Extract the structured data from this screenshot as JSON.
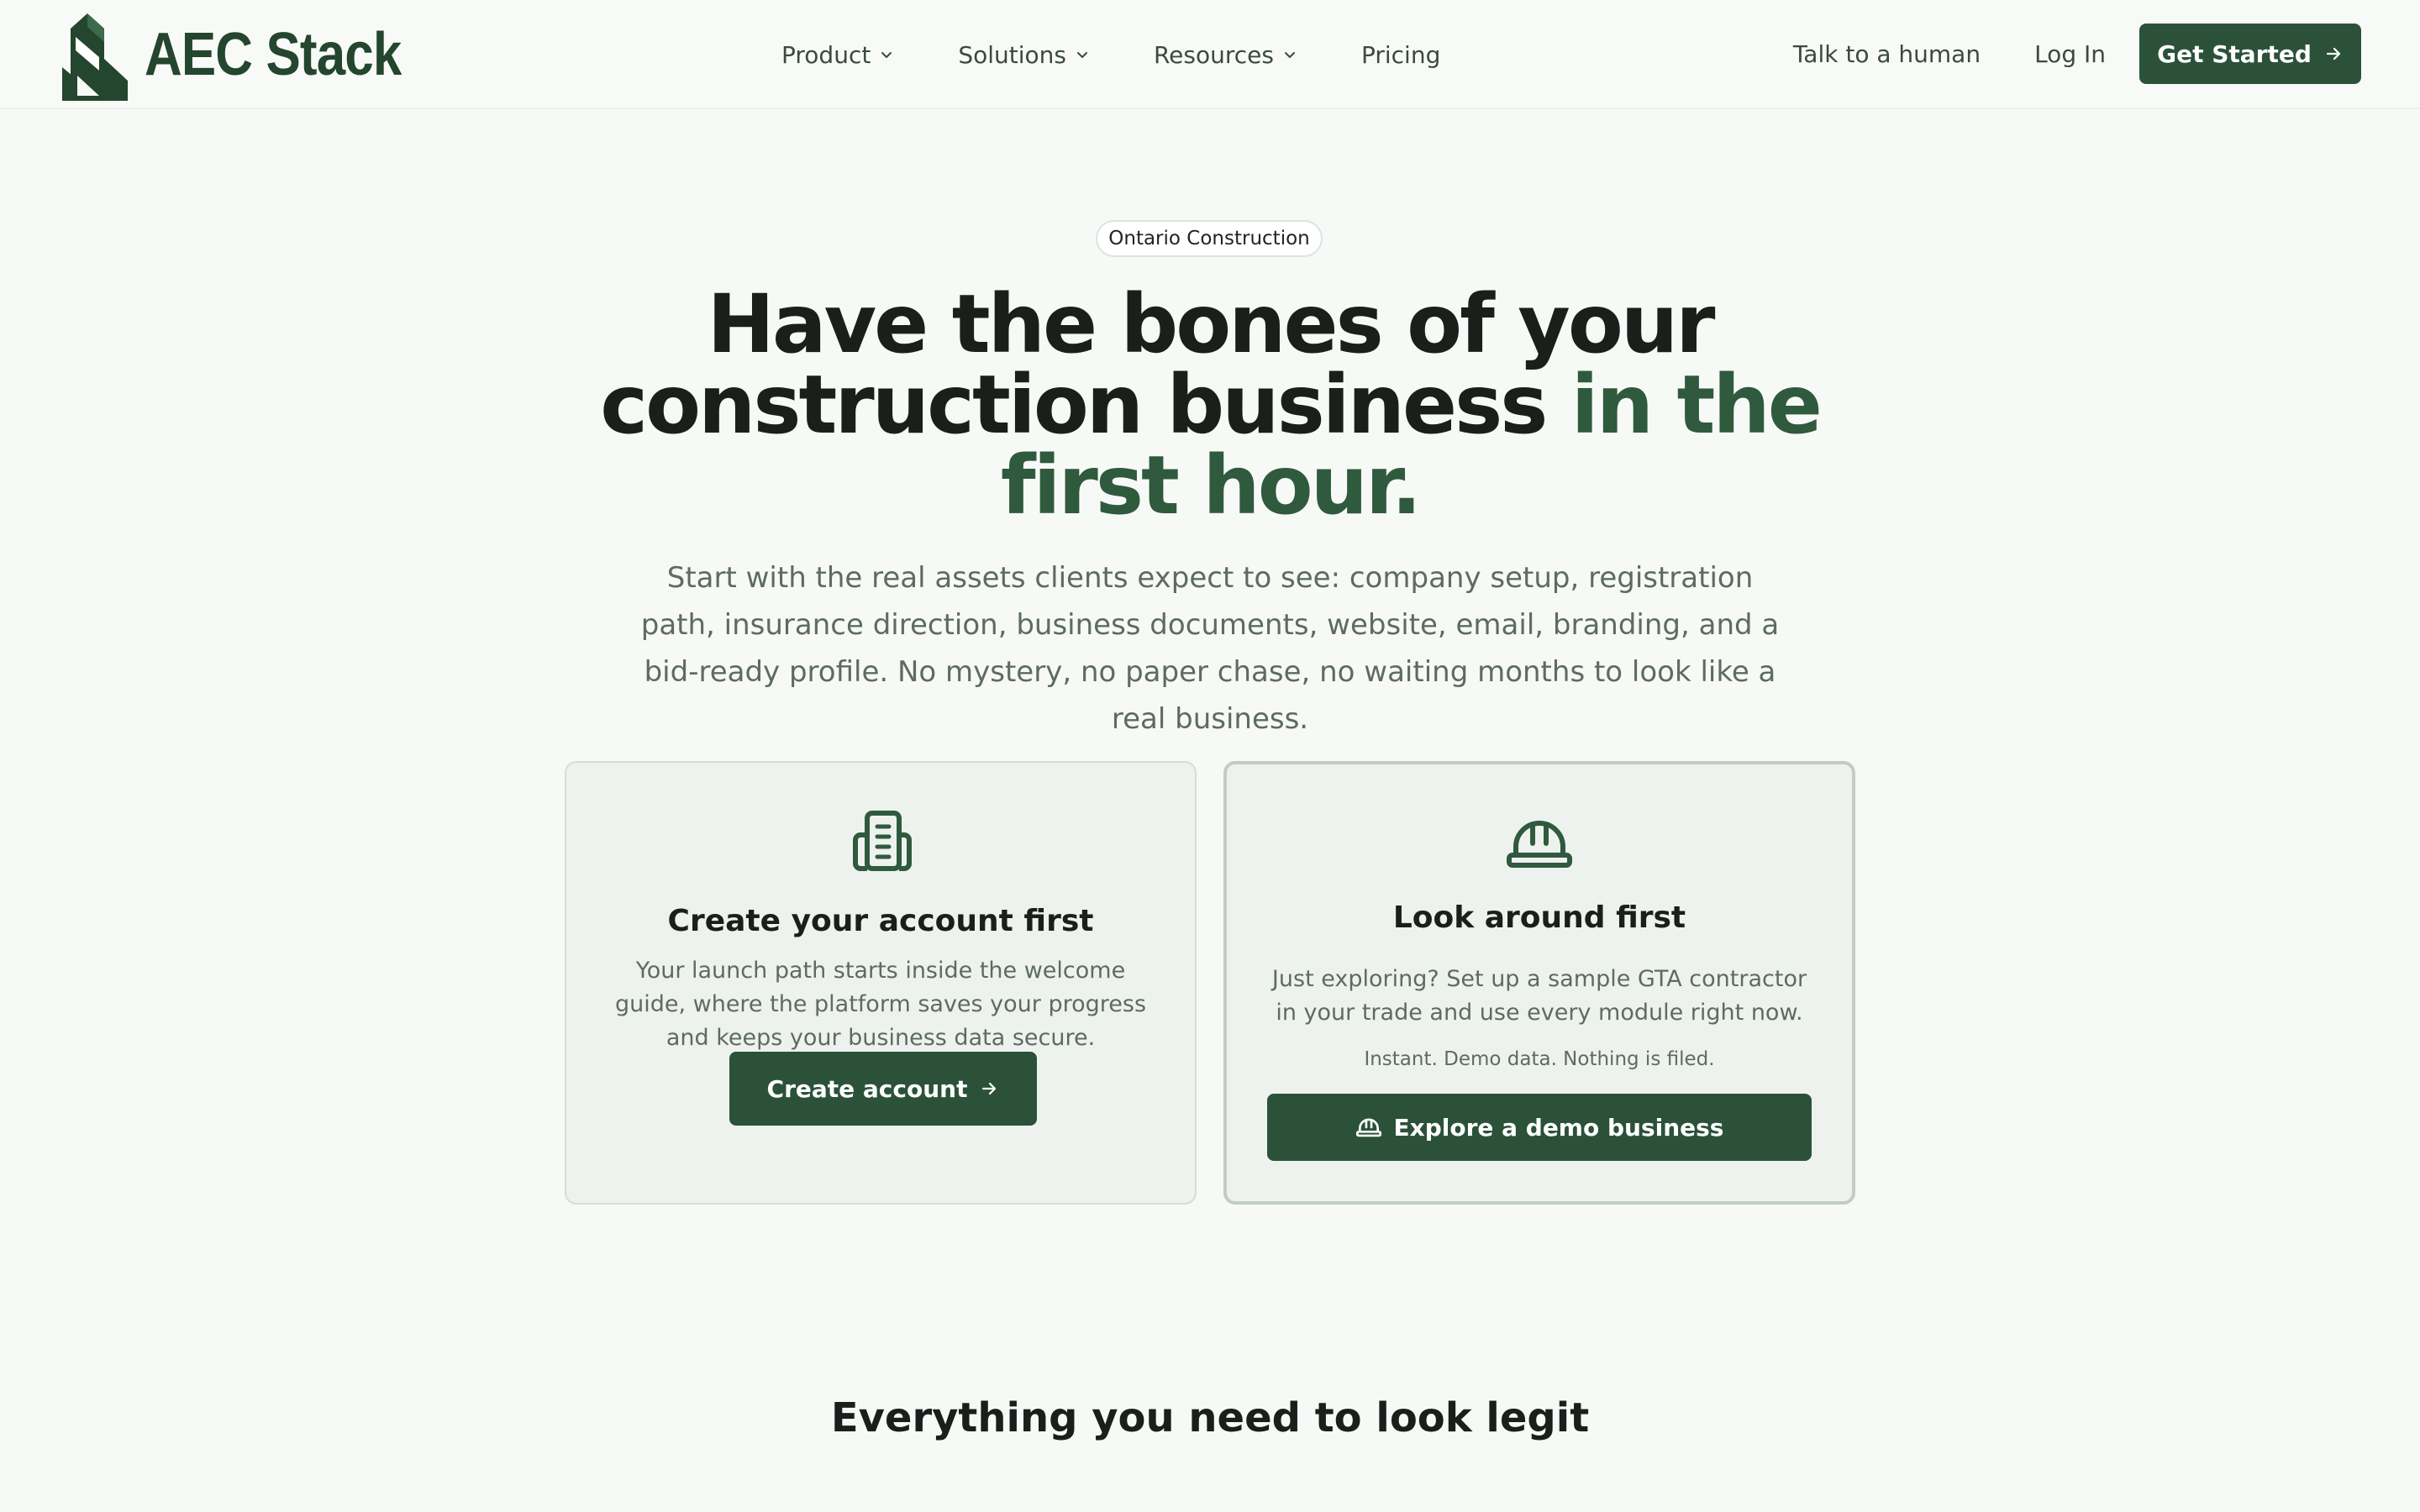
{
  "brand": {
    "name": "AEC Stack",
    "color": "#24452e",
    "accent": "#2b5239"
  },
  "nav": {
    "items": [
      {
        "label": "Product",
        "dropdown": true
      },
      {
        "label": "Solutions",
        "dropdown": true
      },
      {
        "label": "Resources",
        "dropdown": true
      },
      {
        "label": "Pricing",
        "dropdown": false
      }
    ],
    "talk_label": "Talk to a human",
    "login_label": "Log In",
    "cta_label": "Get Started",
    "icons": [
      "chevron-down-icon",
      "arrow-right-icon"
    ]
  },
  "hero": {
    "badge": "Ontario Construction",
    "headline_part1": "Have the bones of your construction business ",
    "headline_accent": "in the first hour.",
    "subhead": "Start with the real assets clients expect to see: company setup, registration path, insurance direction, business documents, website, email, branding, and a bid-ready profile. No mystery, no paper chase, no waiting months to look like a real business."
  },
  "cards": {
    "account": {
      "icon": "building-icon",
      "title": "Create your account first",
      "description": "Your launch path starts inside the welcome guide, where the platform saves your progress and keeps your business data secure.",
      "button_label": "Create account"
    },
    "demo": {
      "icon": "hard-hat-icon",
      "title": "Look around first",
      "description": "Just exploring? Set up a sample GTA contractor in your trade and use every module right now.",
      "note": "Instant. Demo data. Nothing is filed.",
      "button_label": "Explore a demo business"
    }
  },
  "section": {
    "title": "Everything you need to look legit"
  }
}
